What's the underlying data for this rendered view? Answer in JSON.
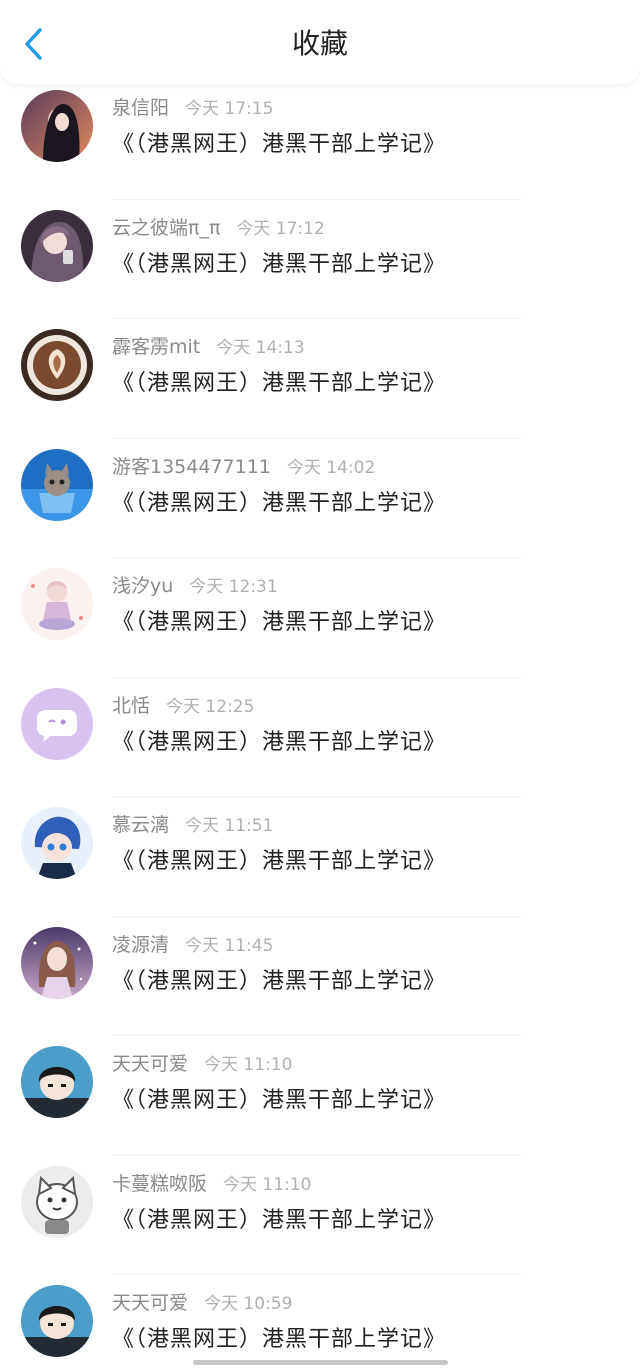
{
  "header": {
    "title": "收藏",
    "back_icon": "chevron-left-icon",
    "accent": "#1a9be6"
  },
  "items": [
    {
      "username": "泉信阳",
      "time": "今天 17:15",
      "title": "《（港黑网王）港黑干部上学记》",
      "avatar": "girl-dark-hair-avatar"
    },
    {
      "username": "云之彼端π_π",
      "time": "今天 17:12",
      "title": "《（港黑网王）港黑干部上学记》",
      "avatar": "girl-selfie-avatar"
    },
    {
      "username": "霹客雳mit",
      "time": "今天 14:13",
      "title": "《（港黑网王）港黑干部上学记》",
      "avatar": "latte-art-avatar"
    },
    {
      "username": "游客1354477111",
      "time": "今天 14:02",
      "title": "《（港黑网王）港黑干部上学记》",
      "avatar": "kitten-cup-avatar"
    },
    {
      "username": "浅汐yu",
      "time": "今天 12:31",
      "title": "《（港黑网王）港黑干部上学记》",
      "avatar": "anime-sitting-avatar"
    },
    {
      "username": "北恬",
      "time": "今天 12:25",
      "title": "《（港黑网王）港黑干部上学记》",
      "avatar": "chat-bubble-avatar"
    },
    {
      "username": "慕云漓",
      "time": "今天 11:51",
      "title": "《（港黑网王）港黑干部上学记》",
      "avatar": "anime-boy-blue-avatar"
    },
    {
      "username": "凌源清",
      "time": "今天 11:45",
      "title": "《（港黑网王）港黑干部上学记》",
      "avatar": "anime-girl-sparkle-avatar"
    },
    {
      "username": "天天可爱",
      "time": "今天 11:10",
      "title": "《（港黑网王）港黑干部上学记》",
      "avatar": "chibi-boy-avatar"
    },
    {
      "username": "卡蔓糕呶阪",
      "time": "今天 11:10",
      "title": "《（港黑网王）港黑干部上学记》",
      "avatar": "cartoon-cat-avatar"
    },
    {
      "username": "天天可爱",
      "time": "今天 10:59",
      "title": "《（港黑网王）港黑干部上学记》",
      "avatar": "chibi-boy-avatar"
    }
  ]
}
